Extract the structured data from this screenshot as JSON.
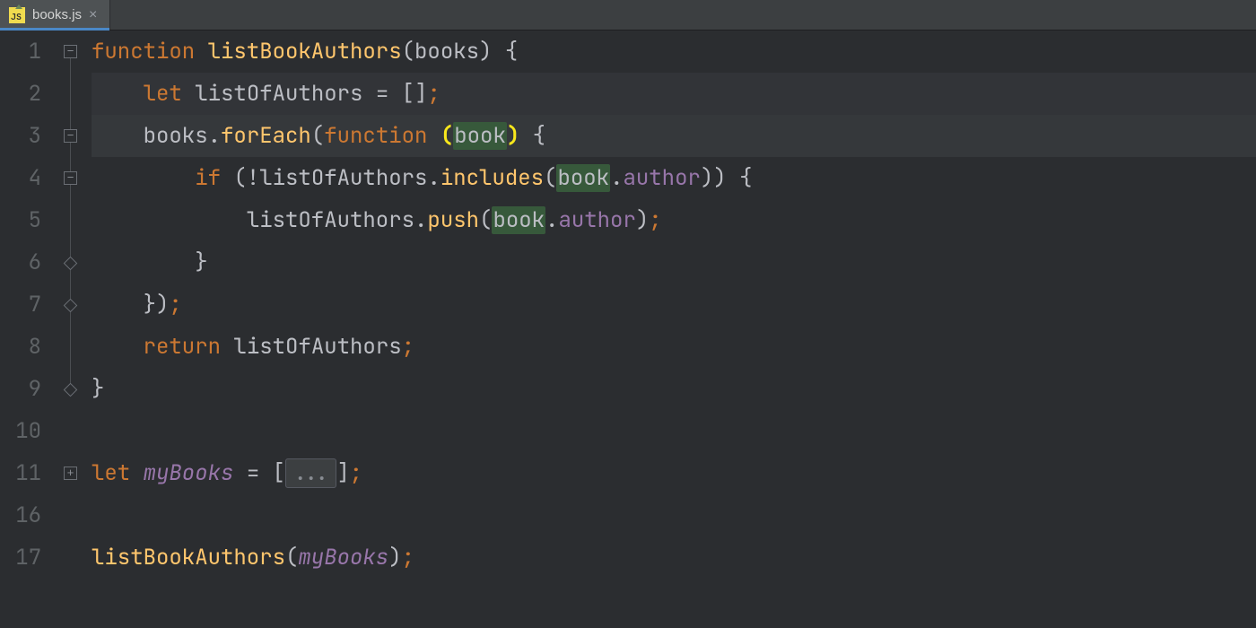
{
  "tab": {
    "filename": "books.js",
    "icon_text": "JS"
  },
  "gutter": [
    "1",
    "2",
    "3",
    "4",
    "5",
    "6",
    "7",
    "8",
    "9",
    "10",
    "11",
    "16",
    "17"
  ],
  "fold": {
    "plus": "+",
    "minus": "−"
  },
  "code": {
    "l1": {
      "kw": "function",
      "sp": " ",
      "fn": "listBookAuthors",
      "open": "(",
      "arg": "books",
      "close": ")",
      "sp2": " ",
      "brace": "{"
    },
    "l2": {
      "indent": "    ",
      "kw": "let",
      "sp": " ",
      "id": "listOfAuthors",
      "sp2": " ",
      "eq": "=",
      "sp3": " ",
      "arr": "[]",
      "semi": ";"
    },
    "l3": {
      "indent": "    ",
      "obj": "books",
      "dot": ".",
      "fn": "forEach",
      "open": "(",
      "kw": "function",
      "sp": " ",
      "popen": "(",
      "param": "book",
      "pclose": ")",
      "sp2": " ",
      "brace": "{"
    },
    "l4": {
      "indent": "        ",
      "kw": "if",
      "sp": " ",
      "open": "(",
      "bang": "!",
      "id": "listOfAuthors",
      "dot": ".",
      "fn": "includes",
      "open2": "(",
      "obj": "book",
      "dot2": ".",
      "prop": "author",
      "close2": ")",
      "close": ")",
      "sp2": " ",
      "brace": "{"
    },
    "l5": {
      "indent": "            ",
      "id": "listOfAuthors",
      "dot": ".",
      "fn": "push",
      "open": "(",
      "obj": "book",
      "dot2": ".",
      "prop": "author",
      "close": ")",
      "semi": ";"
    },
    "l6": {
      "indent": "        ",
      "brace": "}"
    },
    "l7": {
      "indent": "    ",
      "brace": "}",
      "close": ")",
      "semi": ";"
    },
    "l8": {
      "indent": "    ",
      "kw": "return",
      "sp": " ",
      "id": "listOfAuthors",
      "semi": ";"
    },
    "l9": {
      "brace": "}"
    },
    "l10": {
      "blank": ""
    },
    "l11": {
      "kw": "let",
      "sp": " ",
      "id": "myBooks",
      "sp2": " ",
      "eq": "=",
      "sp3": " ",
      "open": "[",
      "fold": "...",
      "close": "]",
      "semi": ";"
    },
    "l16": {
      "blank": ""
    },
    "l17": {
      "fn": "listBookAuthors",
      "open": "(",
      "arg": "myBooks",
      "close": ")",
      "semi": ";"
    }
  }
}
